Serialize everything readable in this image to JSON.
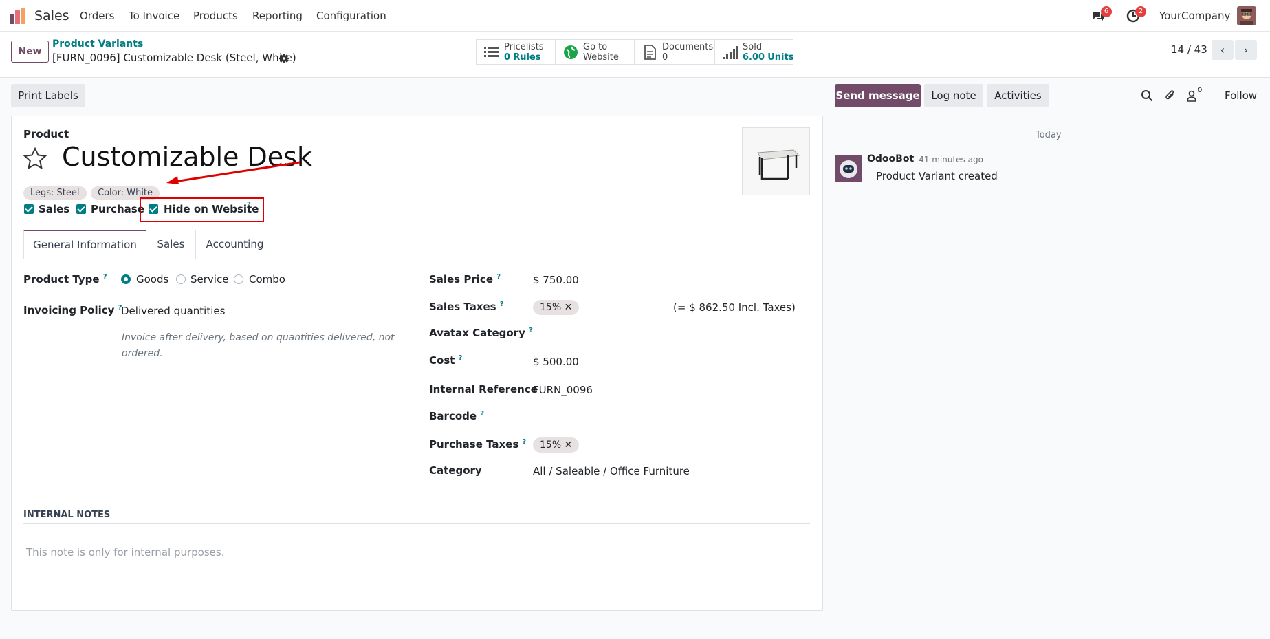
{
  "nav": {
    "app_name": "Sales",
    "menu": [
      "Orders",
      "To Invoice",
      "Products",
      "Reporting",
      "Configuration"
    ],
    "messages_count": "6",
    "activities_count": "2",
    "company": "YourCompany"
  },
  "control_panel": {
    "new_label": "New",
    "breadcrumb_parent": "Product Variants",
    "record_title": "[FURN_0096] Customizable Desk (Steel, White)",
    "stats": [
      {
        "line1": "Pricelists",
        "value": "0",
        "unit": "Rules"
      },
      {
        "line1": "Go to",
        "line2": "Website"
      },
      {
        "line1": "Documents",
        "value": "0"
      },
      {
        "line1": "Sold",
        "value": "6.00",
        "unit": "Units"
      }
    ],
    "pager": "14 / 43"
  },
  "actions": {
    "print_labels": "Print Labels",
    "send_message": "Send message",
    "log_note": "Log note",
    "activities": "Activities",
    "followers_count": "0",
    "follow": "Follow"
  },
  "form": {
    "product_caption": "Product",
    "name": "Customizable Desk",
    "attributes": [
      "Legs: Steel",
      "Color: White"
    ],
    "checks": {
      "sales": "Sales",
      "purchase": "Purchase",
      "hide": "Hide on Website"
    },
    "tabs": [
      "General Information",
      "Sales",
      "Accounting"
    ],
    "left": {
      "product_type_label": "Product Type",
      "product_type_options": [
        "Goods",
        "Service",
        "Combo"
      ],
      "product_type_selected": "Goods",
      "invoicing_policy_label": "Invoicing Policy",
      "invoicing_policy_value": "Delivered quantities",
      "invoicing_policy_help": "Invoice after delivery, based on quantities delivered, not ordered."
    },
    "right": {
      "sales_price_label": "Sales Price",
      "sales_price": "$ 750.00",
      "sales_taxes_label": "Sales Taxes",
      "sales_tax": "15%",
      "incl_taxes": "(= $ 862.50 Incl. Taxes)",
      "avatax_label": "Avatax Category",
      "cost_label": "Cost",
      "cost": "$ 500.00",
      "internal_ref_label": "Internal Reference",
      "internal_ref": "FURN_0096",
      "barcode_label": "Barcode",
      "purchase_taxes_label": "Purchase Taxes",
      "purchase_tax": "15%",
      "category_label": "Category",
      "category": "All / Saleable / Office Furniture"
    },
    "notes_header": "INTERNAL NOTES",
    "notes_placeholder": "This note is only for internal purposes."
  },
  "chatter": {
    "today": "Today",
    "author": "OdooBot",
    "time": "- 41 minutes ago",
    "message": "Product Variant created"
  },
  "colors": {
    "primary": "#714b67",
    "teal": "#017e84",
    "highlight": "#e00000"
  }
}
